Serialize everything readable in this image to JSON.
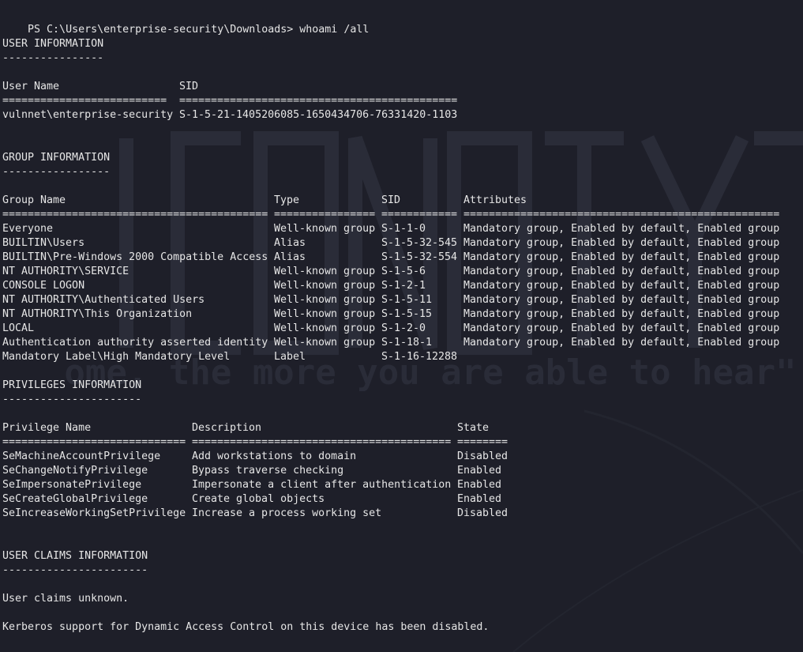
{
  "colors": {
    "background": "#1e1f29",
    "text": "#e6e6e6",
    "watermark": "#2a2c38"
  },
  "prompt": {
    "path": "PS C:\\Users\\enterprise-security\\Downloads>",
    "command": "whoami /all"
  },
  "user_info": {
    "title": "USER INFORMATION",
    "underline": "----------------",
    "headers": [
      "User Name",
      "SID"
    ],
    "separators": [
      "==========================",
      "============================================"
    ],
    "rows": [
      [
        "vulnnet\\enterprise-security",
        "S-1-5-21-1405206085-1650434706-76331420-1103"
      ]
    ]
  },
  "group_info": {
    "title": "GROUP INFORMATION",
    "underline": "-----------------",
    "headers": [
      "Group Name",
      "Type",
      "SID",
      "Attributes"
    ],
    "separators": [
      "==========================================",
      "================",
      "============",
      "=================================================="
    ],
    "rows": [
      [
        "Everyone",
        "Well-known group",
        "S-1-1-0",
        "Mandatory group, Enabled by default, Enabled group"
      ],
      [
        "BUILTIN\\Users",
        "Alias",
        "S-1-5-32-545",
        "Mandatory group, Enabled by default, Enabled group"
      ],
      [
        "BUILTIN\\Pre-Windows 2000 Compatible Access",
        "Alias",
        "S-1-5-32-554",
        "Mandatory group, Enabled by default, Enabled group"
      ],
      [
        "NT AUTHORITY\\SERVICE",
        "Well-known group",
        "S-1-5-6",
        "Mandatory group, Enabled by default, Enabled group"
      ],
      [
        "CONSOLE LOGON",
        "Well-known group",
        "S-1-2-1",
        "Mandatory group, Enabled by default, Enabled group"
      ],
      [
        "NT AUTHORITY\\Authenticated Users",
        "Well-known group",
        "S-1-5-11",
        "Mandatory group, Enabled by default, Enabled group"
      ],
      [
        "NT AUTHORITY\\This Organization",
        "Well-known group",
        "S-1-5-15",
        "Mandatory group, Enabled by default, Enabled group"
      ],
      [
        "LOCAL",
        "Well-known group",
        "S-1-2-0",
        "Mandatory group, Enabled by default, Enabled group"
      ],
      [
        "Authentication authority asserted identity",
        "Well-known group",
        "S-1-18-1",
        "Mandatory group, Enabled by default, Enabled group"
      ],
      [
        "Mandatory Label\\High Mandatory Level",
        "Label",
        "S-1-16-12288",
        ""
      ]
    ]
  },
  "privileges_info": {
    "title": "PRIVILEGES INFORMATION",
    "underline": "----------------------",
    "headers": [
      "Privilege Name",
      "Description",
      "State"
    ],
    "separators": [
      "=============================",
      "=========================================",
      "========"
    ],
    "rows": [
      [
        "SeMachineAccountPrivilege",
        "Add workstations to domain",
        "Disabled"
      ],
      [
        "SeChangeNotifyPrivilege",
        "Bypass traverse checking",
        "Enabled"
      ],
      [
        "SeImpersonatePrivilege",
        "Impersonate a client after authentication",
        "Enabled"
      ],
      [
        "SeCreateGlobalPrivilege",
        "Create global objects",
        "Enabled"
      ],
      [
        "SeIncreaseWorkingSetPrivilege",
        "Increase a process working set",
        "Disabled"
      ]
    ]
  },
  "claims_info": {
    "title": "USER CLAIMS INFORMATION",
    "underline": "-----------------------",
    "message": "User claims unknown.",
    "kerberos": "Kerberos support for Dynamic Access Control on this device has been disabled."
  },
  "watermark": {
    "tagline": "ome, the more you are able to hear\""
  }
}
